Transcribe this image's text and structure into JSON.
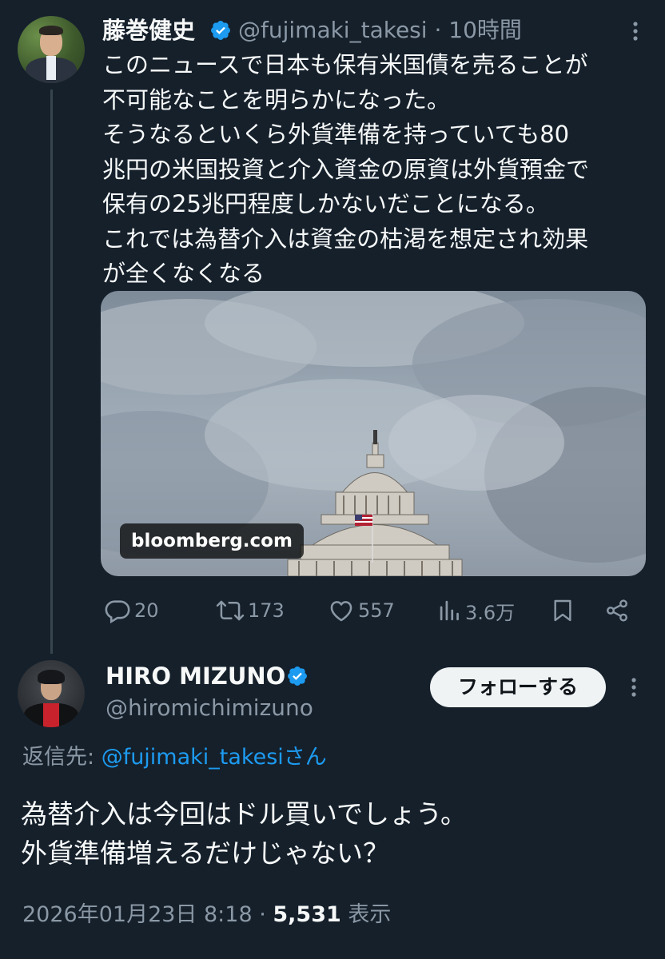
{
  "tweet": {
    "author": {
      "name": "藤巻健史",
      "handle": "@fujimaki_takesi",
      "time": "· 10時間",
      "verified": true
    },
    "text_lines": [
      "このニュースで日本も保有米国債を売ることが",
      "不可能なことを明らかになった。",
      "そうなるといくら外貨準備を持っていても80",
      "兆円の米国投資と介入資金の原資は外貨預金で",
      "保有の25兆円程度しかないだことになる。",
      "これでは為替介入は資金の枯渇を想定され効果",
      "が全くなくなる"
    ],
    "media": {
      "source_label": "bloomberg.com"
    },
    "actions": {
      "replies": "20",
      "retweets": "173",
      "likes": "557",
      "views": "3.6万"
    }
  },
  "reply": {
    "author": {
      "name": "HIRO MIZUNO",
      "handle": "@hiromichimizuno",
      "verified": true
    },
    "follow_label": "フォローする",
    "reply_to_prefix": "返信先: ",
    "reply_to_handle": "@fujimaki_takesi",
    "reply_to_suffix": "さん",
    "text_lines": [
      "為替介入は今回はドル買いでしょう。",
      "外貨準備増えるだけじゃない？"
    ],
    "timestamp": "2026年01月23日 8:18 · ",
    "views_count": "5,531",
    "views_label": " 表示"
  },
  "colors": {
    "background": "#15202b",
    "text_primary": "#f7f9f9",
    "text_secondary": "#8b98a5",
    "link": "#1d9bf0",
    "verified_badge": "#1d9bf0"
  }
}
